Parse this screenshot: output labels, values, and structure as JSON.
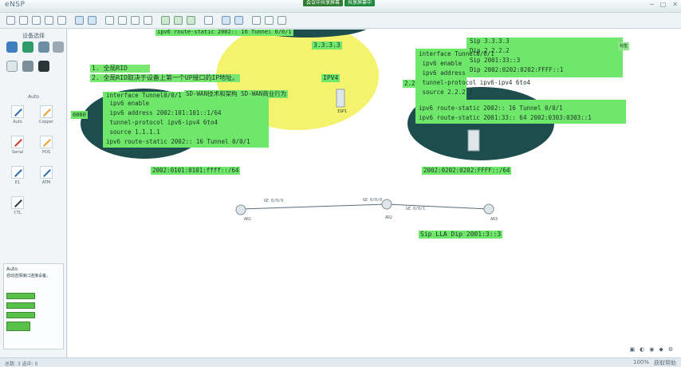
{
  "app": {
    "title": "eNSP",
    "window_controls": [
      "─",
      "□",
      "✕"
    ]
  },
  "meeting": {
    "status": "会议中共享屏幕",
    "share": "共享屏幕中"
  },
  "left_panel": {
    "title": "设备选择",
    "cable_section": "Auto",
    "cables": [
      {
        "label": "Auto",
        "color": "#2f6fb0"
      },
      {
        "label": "Copper",
        "color": "#e6a42a"
      },
      {
        "label": "Serial",
        "color": "#cc3b2f"
      },
      {
        "label": "POS",
        "color": "#e6a42a"
      },
      {
        "label": "E1",
        "color": "#2f6fb0"
      },
      {
        "label": "ATM",
        "color": "#2f6fb0"
      },
      {
        "label": "CTL",
        "color": "#2d3a40"
      }
    ],
    "auto_box": {
      "title": "Auto",
      "desc": "自动选择接口连接设备。"
    }
  },
  "canvas": {
    "left_notes": [
      "1. 全局RID",
      "2. 全局RID取决于设备上第一个UP接口的IP地址。"
    ],
    "top_cmd": "ipv6 route-static 2002:: 16 Tunnel 0/0/1",
    "left_config": [
      "interface Tunnel0/0/1",
      " ipv6 enable",
      " ipv6 address 2002:101:101::1/64",
      " tunnel-protocol ipv6-ipv4 6to4",
      " source 1.1.1.1",
      "ipv6 route-static 2002:: 16 Tunnel 0/0/1"
    ],
    "left_prefix": "0000",
    "sdwan_label": "SD-WAN技术和架构 SD-WAN商业行为",
    "ipv4_label": "IPV4",
    "router_ip": "3.3.3.3",
    "isp_label": "ISP1",
    "right_packet": [
      "Sip 3.3.3.3",
      "Dip 2.2.2.2",
      "Sip 2001:33::3",
      "Dip 2002:0202:0202:FFFF::1"
    ],
    "right_config": [
      "interface Tunnel0/0/1",
      " ipv6 enable",
      " ipv6 address",
      " tunnel-protocol ipv6-ipv4 6to4",
      " source 2.2.2.2",
      "",
      "ipv6 route-static 2002:: 16 Tunnel 0/0/1",
      "ipv6 route-static 2001:33:: 64 2002:0303:0303::1"
    ],
    "right_prefix": "2.2",
    "badge": "标签",
    "left_subnet": "2002:0101:0101:ffff::/64",
    "right_subnet": "2002:0202:0202:FFFF::/64",
    "routers": [
      {
        "name": "AR1",
        "port": "GE 0/0/0"
      },
      {
        "name": "AR2",
        "port": "GE 0/0/0"
      },
      {
        "name": "AR3",
        "port": "GE 0/0/1"
      }
    ],
    "bottom_note": "Sip LLA Dip 2001:3::3"
  },
  "statusbar": {
    "left": "总数: 3   选中: 0",
    "right": [
      "100%",
      "获取帮助"
    ]
  }
}
